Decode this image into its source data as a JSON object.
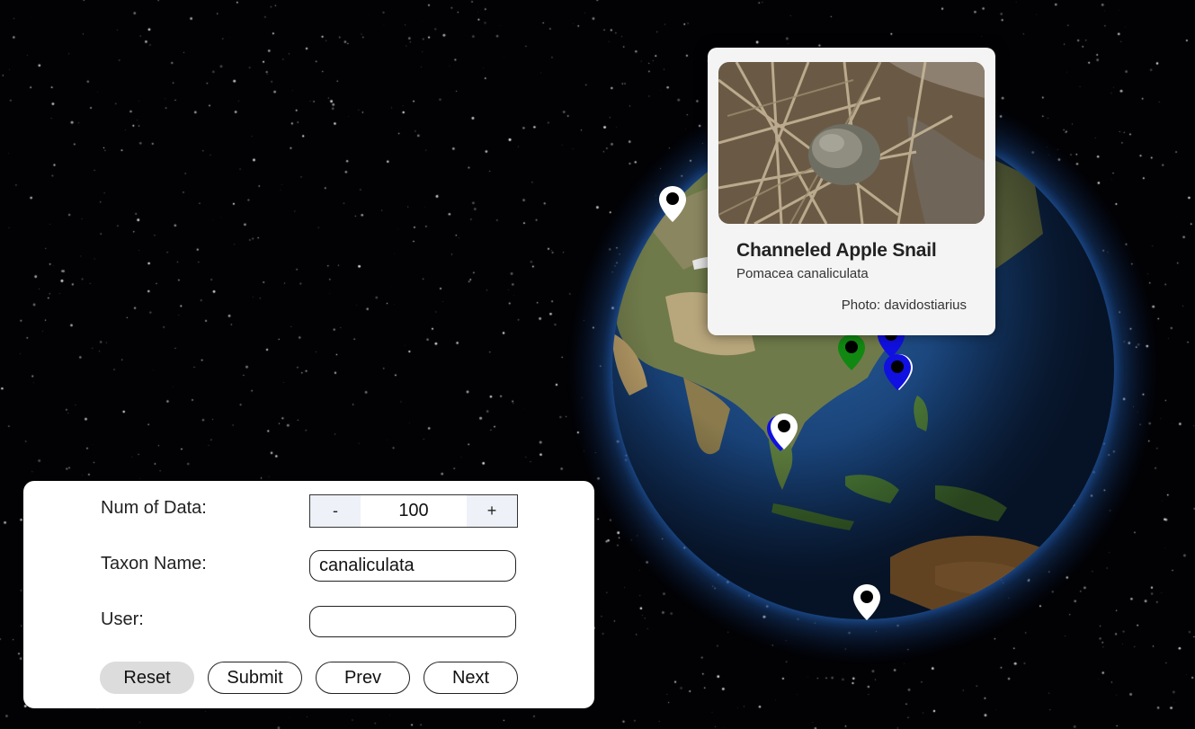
{
  "popup": {
    "common_name": "Channeled Apple Snail",
    "scientific_name": "Pomacea canaliculata",
    "photo_credit": "Photo: davidostiarius"
  },
  "form": {
    "num_label": "Num of Data:",
    "num_value": "100",
    "minus": "-",
    "plus": "+",
    "taxon_label": "Taxon Name:",
    "taxon_value": "canaliculata",
    "user_label": "User:",
    "user_value": "",
    "buttons": {
      "reset": "Reset",
      "submit": "Submit",
      "prev": "Prev",
      "next": "Next"
    }
  },
  "colors": {
    "pin_white": "#ffffff",
    "pin_blue": "#1010e0",
    "pin_green": "#118811"
  }
}
